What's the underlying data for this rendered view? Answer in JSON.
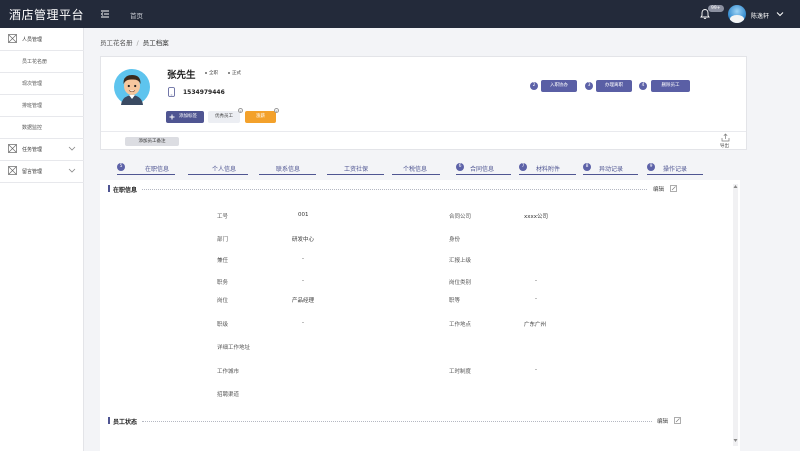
{
  "app": {
    "title": "酒店管理平台",
    "home": "首页"
  },
  "topbar": {
    "notification_count": "99+",
    "username": "陈逸轩"
  },
  "sidebar": {
    "groups": [
      {
        "label": "人员管理",
        "items": [
          "员工花名册",
          "现次管理",
          "排班管理",
          "数据监控"
        ]
      },
      {
        "label": "任务管理"
      },
      {
        "label": "留言管理"
      }
    ]
  },
  "breadcrumb": [
    "员工花名册",
    "员工档案"
  ],
  "profile": {
    "name": "张先生",
    "tags": [
      "全职",
      "正式"
    ],
    "phone": "1534979446",
    "add_tag_label": "添加标签",
    "chips": [
      "优秀员工",
      "涨薪"
    ],
    "actions": [
      {
        "num": "2",
        "label": "入职协办"
      },
      {
        "num": "3",
        "label": "办理离职"
      },
      {
        "num": "4",
        "label": "删除员工"
      }
    ],
    "note_button": "添加员工备注",
    "export_label": "导出"
  },
  "tabs": [
    {
      "num": "5",
      "label": "在职信息"
    },
    {
      "num": "",
      "label": "个人信息"
    },
    {
      "num": "",
      "label": "联系信息"
    },
    {
      "num": "",
      "label": "工资社保"
    },
    {
      "num": "",
      "label": "个税信息"
    },
    {
      "num": "6",
      "label": "合同信息"
    },
    {
      "num": "7",
      "label": "材料附件"
    },
    {
      "num": "8",
      "label": "异动记录"
    },
    {
      "num": "9",
      "label": "操作记录"
    }
  ],
  "sections": {
    "employment": {
      "title": "在职信息",
      "edit": "编辑"
    },
    "status": {
      "title": "员工状态",
      "edit": "编辑"
    }
  },
  "fields": {
    "left": [
      {
        "label": "工号",
        "value": "001"
      },
      {
        "label": "部门",
        "value": "研发中心"
      },
      {
        "label": "兼任",
        "value": "-"
      },
      {
        "label": "职务",
        "value": "-"
      },
      {
        "label": "岗位",
        "value": "产品经理"
      },
      {
        "label": "职级",
        "value": "-"
      },
      {
        "label": "详细工作地址",
        "value": ""
      },
      {
        "label": "工作城市",
        "value": ""
      },
      {
        "label": "招聘渠道",
        "value": ""
      }
    ],
    "right": [
      {
        "label": "合同公司",
        "value": "xxxx公司"
      },
      {
        "label": "身份",
        "value": ""
      },
      {
        "label": "汇报上级",
        "value": ""
      },
      {
        "label": "岗位类别",
        "value": "-"
      },
      {
        "label": "职等",
        "value": "-"
      },
      {
        "label": "工作地点",
        "value": "广东广州"
      },
      {
        "label": "工时制度",
        "value": "-"
      }
    ]
  },
  "colors": {
    "topbar": "#232a3a",
    "accent": "#4f5592",
    "orange": "#f3a12b"
  }
}
